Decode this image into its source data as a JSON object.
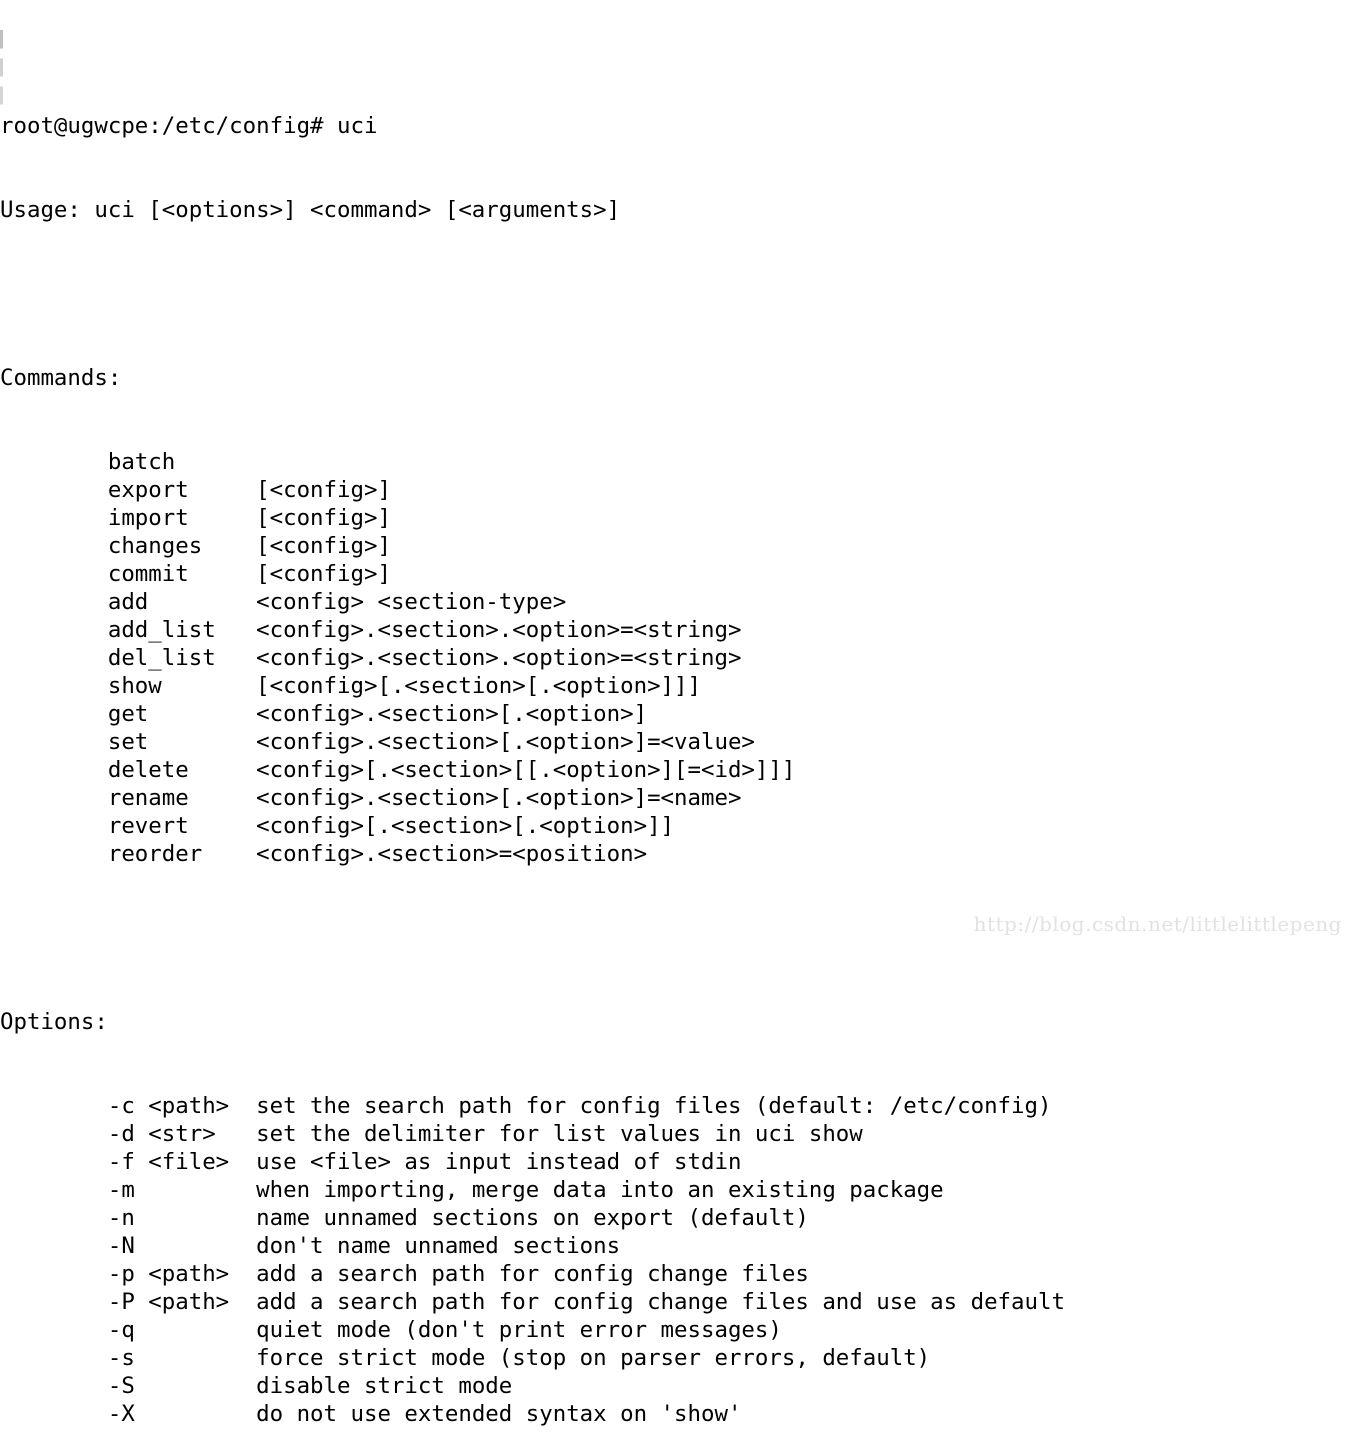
{
  "terminal": {
    "prompt": "root@ugwcpe:/etc/config# uci",
    "usage": "Usage: uci [<options>] <command> [<arguments>]",
    "commands_header": "Commands:",
    "options_header": "Options:",
    "indent": "        ",
    "command_column_width": 11,
    "commands": [
      {
        "name": "batch",
        "args": ""
      },
      {
        "name": "export",
        "args": "[<config>]"
      },
      {
        "name": "import",
        "args": "[<config>]"
      },
      {
        "name": "changes",
        "args": "[<config>]"
      },
      {
        "name": "commit",
        "args": "[<config>]"
      },
      {
        "name": "add",
        "args": "<config> <section-type>"
      },
      {
        "name": "add_list",
        "args": "<config>.<section>.<option>=<string>"
      },
      {
        "name": "del_list",
        "args": "<config>.<section>.<option>=<string>"
      },
      {
        "name": "show",
        "args": "[<config>[.<section>[.<option>]]]"
      },
      {
        "name": "get",
        "args": "<config>.<section>[.<option>]"
      },
      {
        "name": "set",
        "args": "<config>.<section>[.<option>]=<value>"
      },
      {
        "name": "delete",
        "args": "<config>[.<section>[[.<option>][=<id>]]]"
      },
      {
        "name": "rename",
        "args": "<config>.<section>[.<option>]=<name>"
      },
      {
        "name": "revert",
        "args": "<config>[.<section>[.<option>]]"
      },
      {
        "name": "reorder",
        "args": "<config>.<section>=<position>"
      }
    ],
    "options": [
      {
        "flag": "-c <path>",
        "description": "set the search path for config files (default: /etc/config)"
      },
      {
        "flag": "-d <str>",
        "description": "set the delimiter for list values in uci show"
      },
      {
        "flag": "-f <file>",
        "description": "use <file> as input instead of stdin"
      },
      {
        "flag": "-m",
        "description": "when importing, merge data into an existing package"
      },
      {
        "flag": "-n",
        "description": "name unnamed sections on export (default)"
      },
      {
        "flag": "-N",
        "description": "don't name unnamed sections"
      },
      {
        "flag": "-p <path>",
        "description": "add a search path for config change files"
      },
      {
        "flag": "-P <path>",
        "description": "add a search path for config change files and use as default"
      },
      {
        "flag": "-q",
        "description": "quiet mode (don't print error messages)"
      },
      {
        "flag": "-s",
        "description": "force strict mode (stop on parser errors, default)"
      },
      {
        "flag": "-S",
        "description": "disable strict mode"
      },
      {
        "flag": "-X",
        "description": "do not use extended syntax on 'show'"
      }
    ]
  },
  "watermark": {
    "text": "http://blog.csdn.net/littlelittlepeng"
  },
  "colors": {
    "background": "#ffffff",
    "foreground": "#000000",
    "watermark": "#e2e2e2"
  }
}
